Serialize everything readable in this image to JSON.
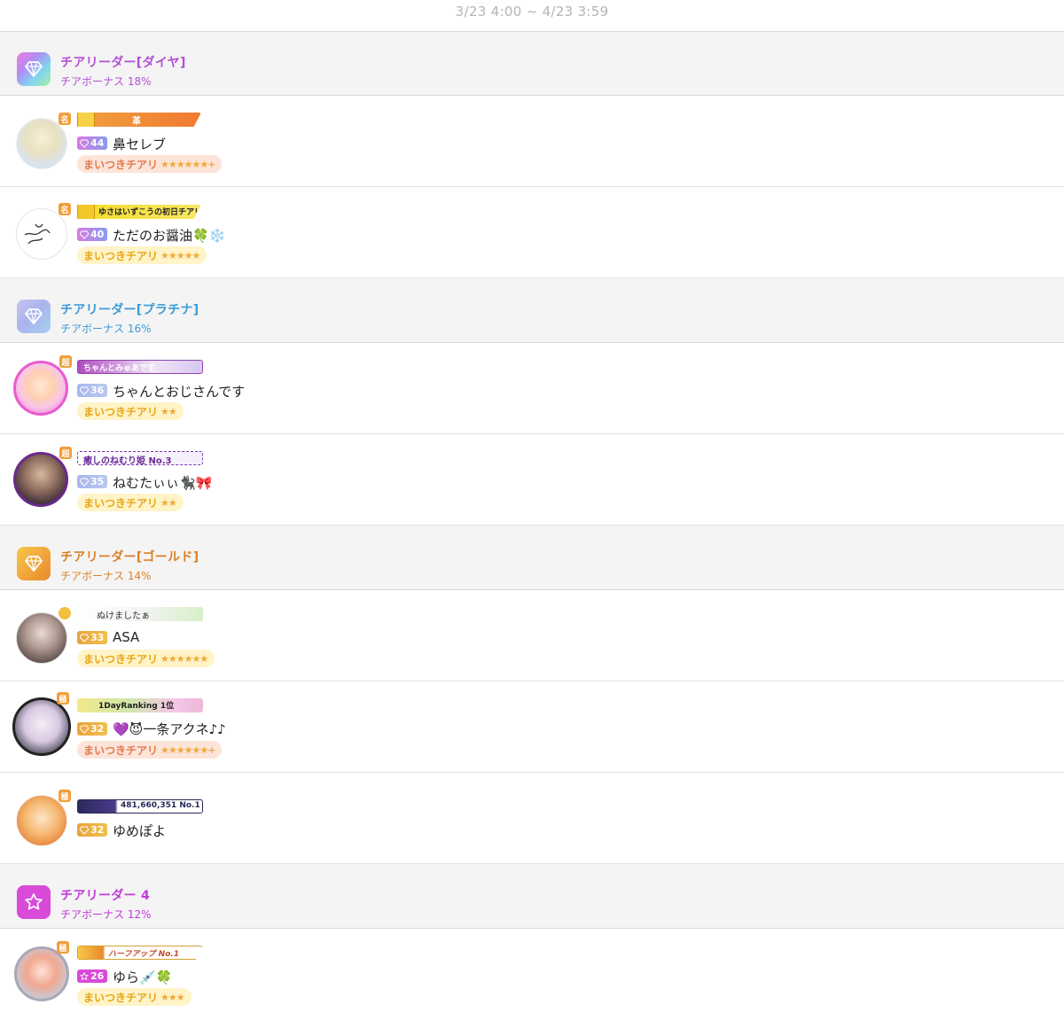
{
  "period": "3/23 4:00 ~ 4/23 3:59",
  "colors": {
    "diamond": "#b44fd6",
    "platinum": "#3d9bd6",
    "gold": "#d9822b",
    "rank4": "#c23bd9",
    "cheer_pink_bg": "#fde4d9",
    "cheer_pink_text": "#e27a4c",
    "cheer_yellow_bg": "#fff3c8",
    "cheer_yellow_text": "#e8a712"
  },
  "sections": [
    {
      "title": "チアリーダー[ダイヤ]",
      "bonus": "チアボーナス 18%",
      "icon": "diamond-icon",
      "users": [
        {
          "level": "44",
          "name": "鼻セレブ",
          "cheer": "まいつきチアリ",
          "stars": "★★★★★★+",
          "title_text": "革"
        },
        {
          "level": "40",
          "name": "ただのお醤油🍀❄️",
          "cheer": "まいつきチアリ",
          "stars": "★★★★★",
          "title_text": "ゆさはいずこうの初日チアリ"
        }
      ]
    },
    {
      "title": "チアリーダー[プラチナ]",
      "bonus": "チアボーナス 16%",
      "icon": "diamond-icon",
      "users": [
        {
          "level": "36",
          "name": "ちゃんとおじさんです",
          "cheer": "まいつきチアリ",
          "stars": "★★",
          "title_text": "ちゃんとみゅあです"
        },
        {
          "level": "35",
          "name": "ねむたぃぃ🐈‍⬛🎀",
          "cheer": "まいつきチアリ",
          "stars": "★★",
          "title_text": "癒しのねむり姫 No.3"
        }
      ]
    },
    {
      "title": "チアリーダー[ゴールド]",
      "bonus": "チアボーナス 14%",
      "icon": "diamond-icon",
      "users": [
        {
          "level": "33",
          "name": "ASA",
          "cheer": "まいつきチアリ",
          "stars": "★★★★★★",
          "title_text": "ぬけましたぁ"
        },
        {
          "level": "32",
          "name": "💜😈一条アクネ♪♪",
          "cheer": "まいつきチアリ",
          "stars": "★★★★★★+",
          "title_text": "1DayRanking 1位"
        },
        {
          "level": "32",
          "name": "ゆめぽよ",
          "cheer": "",
          "stars": "",
          "title_text": "481,660,351 No.1"
        }
      ]
    },
    {
      "title": "チアリーダー 4",
      "bonus": "チアボーナス 12%",
      "icon": "star-icon",
      "users": [
        {
          "level": "26",
          "name": "ゆら💉🍀",
          "cheer": "まいつきチアリ",
          "stars": "★★★",
          "title_text": "ハーフアップ No.1"
        }
      ]
    }
  ]
}
